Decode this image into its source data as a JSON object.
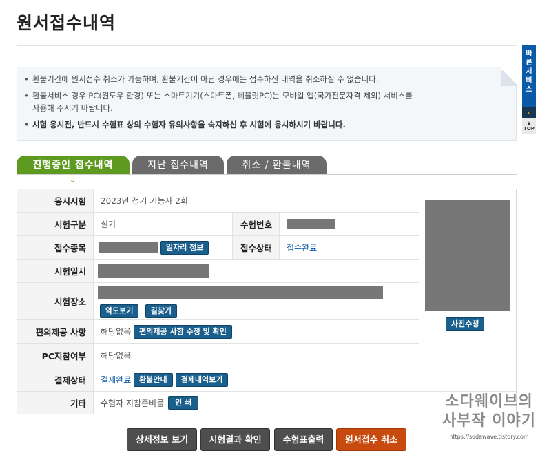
{
  "page": {
    "title": "원서접수내역"
  },
  "notice": {
    "items": [
      {
        "text": "환불기간에 원서접수 취소가 가능하며, 환불기간이 아닌 경우에는 접수하신 내역을 취소하실 수 없습니다."
      },
      {
        "line1": "환불서비스 경우 PC(윈도우 환경) 또는 스마트기기(스마트폰, 테블릿PC)는 모바일 앱(국가전문자격 제외) 서비스를",
        "line2": "사용해 주시기 바랍니다."
      },
      {
        "text": "시험 응시전, 반드시 수험표 상의 수험자 유의사항을 숙지하신 후 시험에 응시하시기 바랍니다."
      }
    ]
  },
  "quick_menu": {
    "label": "빠른서비스",
    "arrow": "‹",
    "top": "TOP"
  },
  "tabs": [
    {
      "label": "진행중인 접수내역",
      "active": true
    },
    {
      "label": "지난 접수내역",
      "active": false
    },
    {
      "label": "취소 / 환불내역",
      "active": false
    }
  ],
  "tab_indicator": "⌄",
  "info": {
    "exam": {
      "label": "응시시험",
      "value": "2023년 정기 기능사 2회"
    },
    "category": {
      "label": "시험구분",
      "value": "실기"
    },
    "exam_number": {
      "label": "수험번호"
    },
    "job_field": {
      "label": "접수종목",
      "button": "일자리 정보"
    },
    "status": {
      "label": "접수상태",
      "value": "접수완료"
    },
    "datetime": {
      "label": "시험일시"
    },
    "location": {
      "label": "시험장소",
      "map_button": "약도보기",
      "route_button": "길찾기"
    },
    "accommodation": {
      "label": "편의제공 사항",
      "value": "해당없음",
      "button": "편의제공 사항 수정 및 확인"
    },
    "pc_participation": {
      "label": "PC지참여부",
      "value": "해당없음"
    },
    "payment": {
      "label": "결제상태",
      "value": "결제완료",
      "refund_button": "환불안내",
      "history_button": "결제내역보기"
    },
    "etc": {
      "label": "기타",
      "value": "수험자 지참준비물",
      "print_button": "인 쇄"
    },
    "photo": {
      "edit_button": "사진수정"
    }
  },
  "actions": {
    "detail": "상세정보 보기",
    "result": "시험결과 확인",
    "ticket": "수험표출력",
    "cancel": "원서접수 취소"
  },
  "watermark": {
    "line1": "소다웨이브의",
    "line2": "사부작 이야기",
    "url": "https://sodawave.tistory.com"
  },
  "colors": {
    "active_tab": "#5d9a1f",
    "inactive_tab": "#6b6b6b",
    "button_blue": "#1b5f8c",
    "cancel_orange": "#c84a0e",
    "quick_blue": "#0b5aa8"
  }
}
